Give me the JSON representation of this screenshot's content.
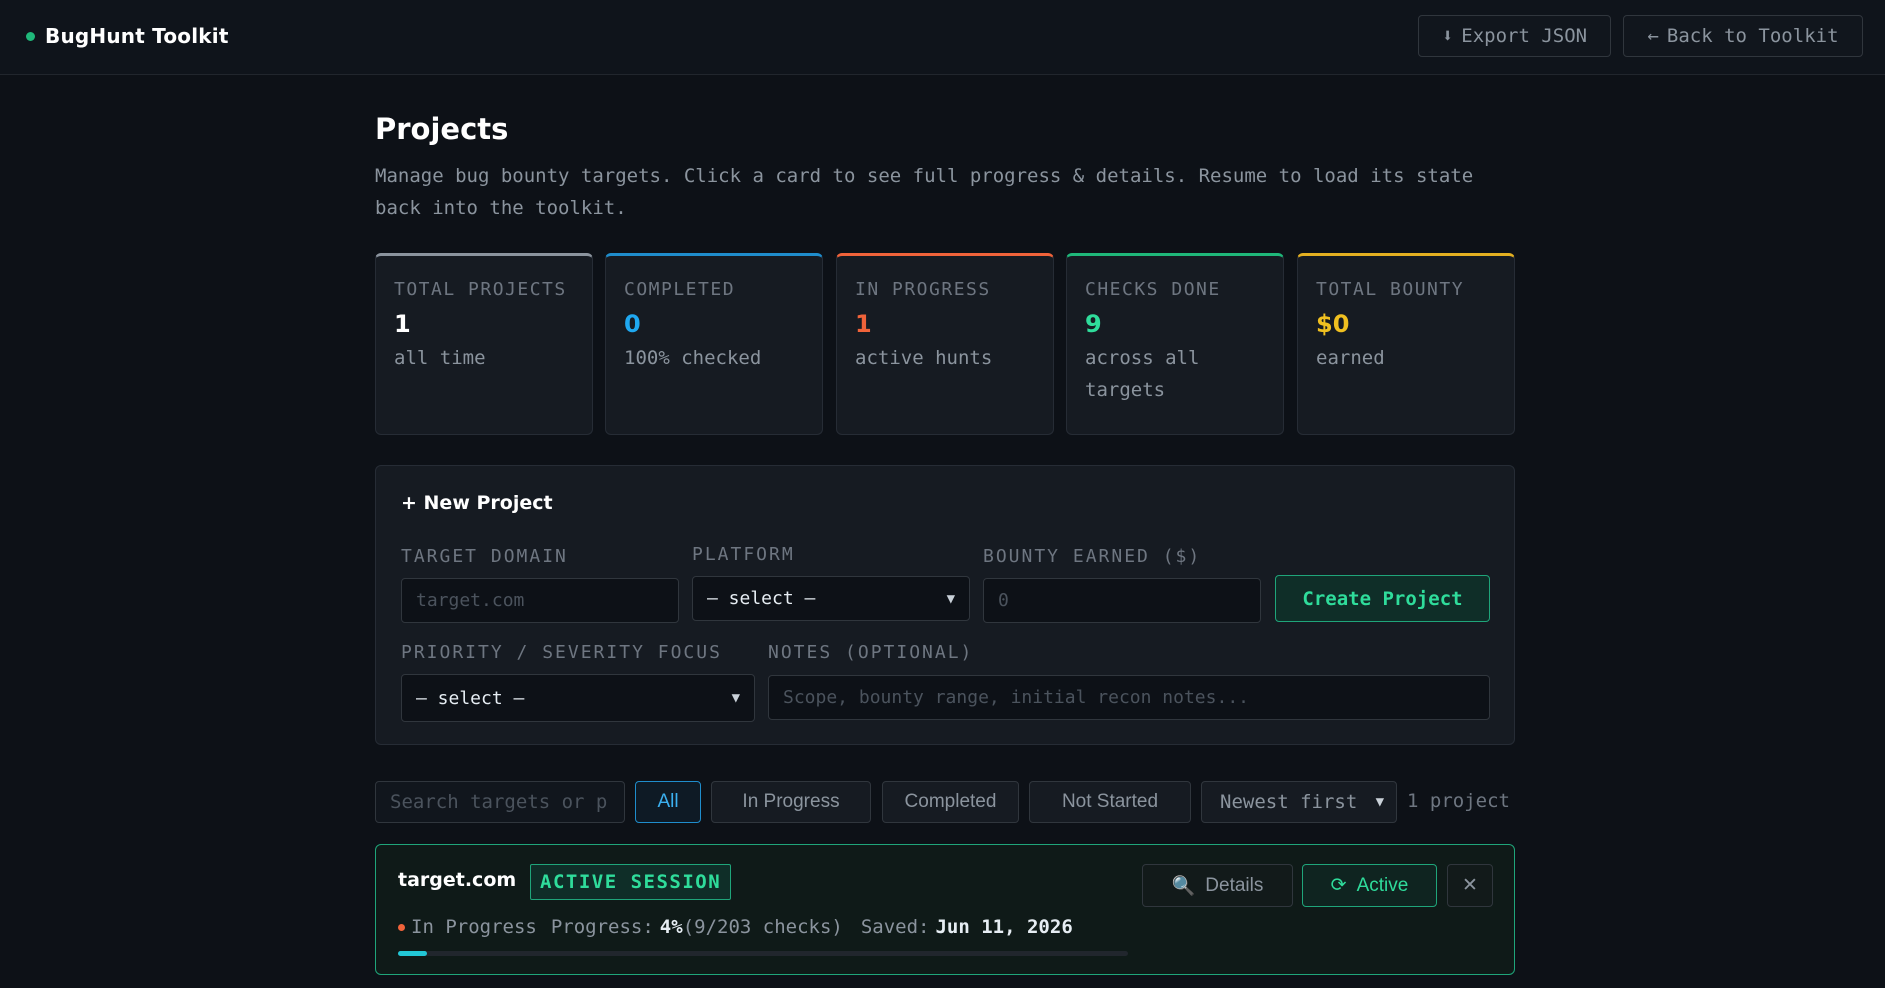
{
  "app": {
    "title": "BugHunt Toolkit",
    "brand_color": "#1fb87a"
  },
  "header": {
    "export_label": "Export JSON",
    "export_icon": "⬇",
    "back_label": "Back to Toolkit",
    "back_icon": "←"
  },
  "page": {
    "title": "Projects",
    "description": "Manage bug bounty targets. Click a card to see full progress & details. Resume to load its state back into the toolkit."
  },
  "stats": [
    {
      "label": "Total Projects",
      "value": "1",
      "sub": "all time",
      "accent": "#8b949e",
      "value_color": "#ffffff"
    },
    {
      "label": "Completed",
      "value": "0",
      "sub": "100% checked",
      "accent": "#1f8dcc",
      "value_color": "#1fa8f0"
    },
    {
      "label": "In Progress",
      "value": "1",
      "sub": "active hunts",
      "accent": "#f0633a",
      "value_color": "#f0633a"
    },
    {
      "label": "Checks Done",
      "value": "9",
      "sub": "across all targets",
      "accent": "#1fb87a",
      "value_color": "#2fdc9b"
    },
    {
      "label": "Total Bounty",
      "value": "$0",
      "sub": "earned",
      "accent": "#e3b021",
      "value_color": "#f0c020"
    }
  ],
  "new_project": {
    "title": "+ New Project",
    "target_label": "Target Domain",
    "target_placeholder": "target.com",
    "platform_label": "Platform",
    "platform_value": "— select —",
    "bounty_label": "Bounty Earned ($)",
    "bounty_placeholder": "0",
    "create_label": "Create Project",
    "priority_label": "Priority / Severity Focus",
    "priority_value": "— select —",
    "notes_label": "Notes (optional)",
    "notes_placeholder": "Scope, bounty range, initial recon notes..."
  },
  "filters": {
    "search_placeholder": "Search targets or p",
    "tabs": [
      "All",
      "In Progress",
      "Completed",
      "Not Started"
    ],
    "active_tab": "All",
    "sort_value": "Newest first",
    "count_text": "1 project"
  },
  "projects": [
    {
      "domain": "target.com",
      "badge": "ACTIVE SESSION",
      "status": "In Progress",
      "status_color": "#f0633a",
      "progress_label": "Progress:",
      "progress_pct": "4%",
      "progress_fraction": 0.04,
      "checks_text": "(9/203 checks)",
      "saved_label": "Saved:",
      "saved_date": "Jun 11, 2026",
      "details_label": "Details",
      "details_icon": "🔍",
      "resume_label": "Active",
      "resume_icon": "⟳",
      "delete_icon": "✕"
    }
  ]
}
